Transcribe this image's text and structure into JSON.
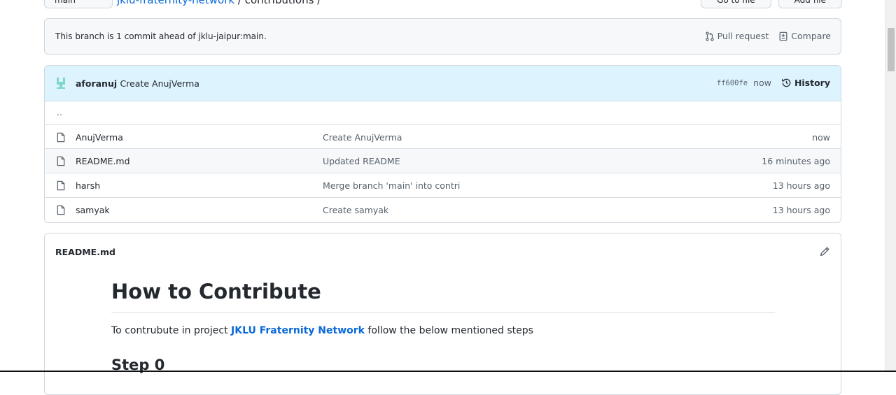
{
  "top": {
    "branch": "main",
    "repo": "jklu-fraternity-network",
    "path": "/ contributions /",
    "go_to_file": "Go to file",
    "add_file": "Add file"
  },
  "branch_info": {
    "message": "This branch is 1 commit ahead of jklu-jaipur:main.",
    "pull_request": "Pull request",
    "compare": "Compare"
  },
  "commit": {
    "author": "aforanuj",
    "message": "Create AnujVerma",
    "sha": "ff600fe",
    "time": "now",
    "history": "History"
  },
  "parent_dir": "..",
  "files": [
    {
      "name": "AnujVerma",
      "message": "Create AnujVerma",
      "time": "now"
    },
    {
      "name": "README.md",
      "message": "Updated README",
      "time": "16 minutes ago"
    },
    {
      "name": "harsh",
      "message": "Merge branch 'main' into contri",
      "time": "13 hours ago"
    },
    {
      "name": "samyak",
      "message": "Create samyak",
      "time": "13 hours ago"
    }
  ],
  "readme": {
    "title": "README.md",
    "heading": "How to Contribute",
    "para_before": "To contrubute in project ",
    "para_link": "JKLU Fraternity Network",
    "para_after": " follow the below mentioned steps",
    "step": "Step 0"
  },
  "icons": {
    "file": "file-icon",
    "pull_request": "git-pull-request-icon",
    "compare": "diff-icon",
    "history": "history-icon",
    "edit": "pencil-icon"
  },
  "colors": {
    "link": "#0969da",
    "commit_bg": "#ddf4ff",
    "border": "#d0d7de"
  }
}
